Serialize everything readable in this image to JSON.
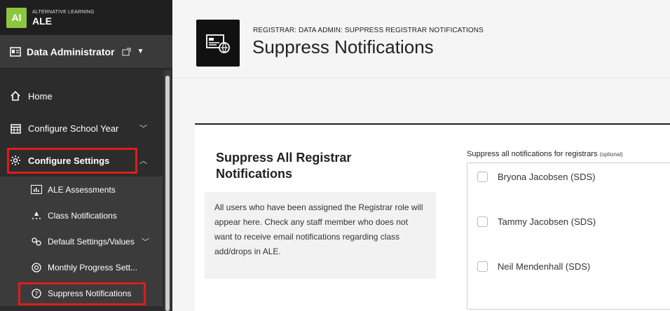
{
  "brand": {
    "logo": "Al",
    "tagline": "ALTERNATIVE LEARNING",
    "name": "ALE"
  },
  "role": {
    "label": "Data Administrator"
  },
  "nav": {
    "home": "Home",
    "configure_school_year": "Configure School Year",
    "configure_settings": "Configure Settings",
    "sub_items": [
      {
        "label": "ALE Assessments",
        "icon": "chart-icon"
      },
      {
        "label": "Class Notifications",
        "icon": "bell-icon"
      },
      {
        "label": "Default Settings/Values",
        "icon": "cogs-icon"
      },
      {
        "label": "Monthly Progress Sett...",
        "icon": "progress-icon"
      },
      {
        "label": "Suppress Notifications",
        "icon": "question-icon"
      }
    ]
  },
  "header": {
    "breadcrumb": "REGISTRAR: DATA ADMIN: SUPPRESS REGISTRAR NOTIFICATIONS",
    "title": "Suppress Notifications"
  },
  "section": {
    "title": "Suppress All Registrar Notifications",
    "description": "All users who have been assigned the Registrar role will appear here. Check any staff member who does not want to receive email notifications regarding class add/drops in ALE.",
    "field_label": "Suppress all notifications for registrars",
    "field_optional": "(optional)",
    "registrars": [
      {
        "name": "Bryona Jacobsen (SDS)",
        "checked": false
      },
      {
        "name": "Tammy Jacobsen (SDS)",
        "checked": false
      },
      {
        "name": "Neil Mendenhall (SDS)",
        "checked": false
      }
    ]
  },
  "colors": {
    "brand_green": "#8cc63f",
    "highlight_red": "#e01b1b",
    "sidebar": "#2c2c2c"
  }
}
